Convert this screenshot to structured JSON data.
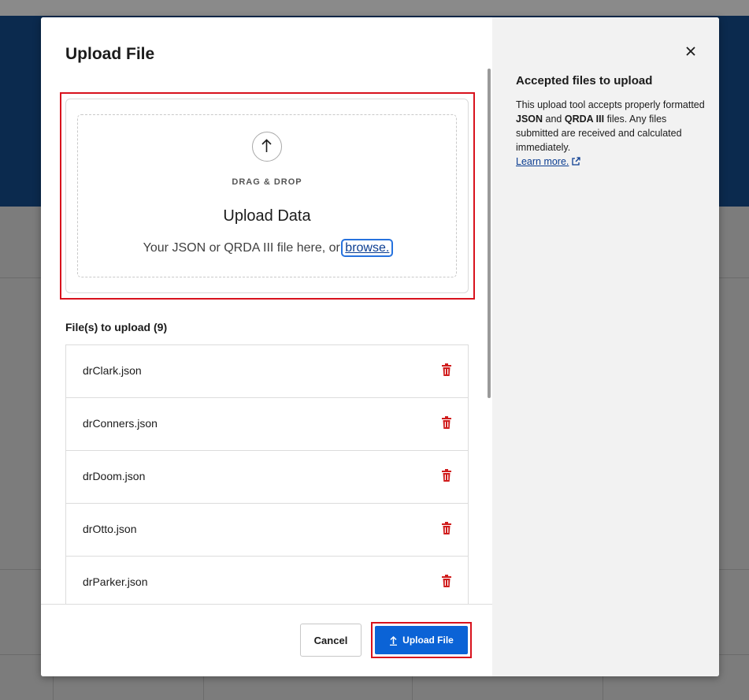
{
  "modal": {
    "title": "Upload File"
  },
  "dropzone": {
    "caption": "DRAG & DROP",
    "heading": "Upload Data",
    "text_prefix": "Your JSON or QRDA III file here, or ",
    "browse_label": "browse."
  },
  "files": {
    "label": "File(s) to upload (9)",
    "items": [
      {
        "name": "drClark.json"
      },
      {
        "name": "drConners.json"
      },
      {
        "name": "drDoom.json"
      },
      {
        "name": "drOtto.json"
      },
      {
        "name": "drParker.json"
      }
    ]
  },
  "footer": {
    "cancel_label": "Cancel",
    "upload_label": "Upload File"
  },
  "side_panel": {
    "title": "Accepted files to upload",
    "text_1": "This upload tool accepts properly formatted ",
    "bold_json": "JSON",
    "text_2": " and ",
    "bold_qrda": "QRDA III",
    "text_3": " files. Any files submitted are received and calculated immediately.",
    "learn_more": "Learn more."
  },
  "colors": {
    "accent_blue": "#0b63d6",
    "highlight_red": "#d8121d",
    "trash_red": "#d01c1c",
    "header_navy": "#0b2a4e"
  },
  "icons": [
    "upload-arrow-icon",
    "trash-icon",
    "close-icon",
    "external-link-icon"
  ]
}
